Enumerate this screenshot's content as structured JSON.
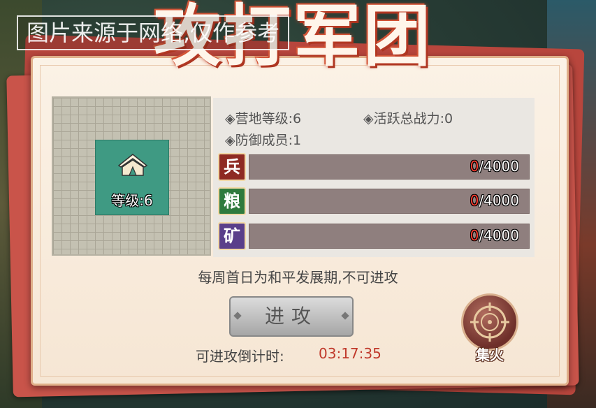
{
  "title": "攻打军团",
  "watermark": "图片来源于网络,仅作参考",
  "camp": {
    "level_label": "等级:6"
  },
  "stats": {
    "camp_level": "◈营地等级:6",
    "active_power": "◈活跃总战力:0",
    "defense_members": "◈防御成员:1"
  },
  "resources": [
    {
      "icon": "兵",
      "current": "0",
      "max": "/4000",
      "color": "#8e2a23",
      "progress": 0
    },
    {
      "icon": "粮",
      "current": "0",
      "max": "/4000",
      "color": "#2e7a3d",
      "progress": 0
    },
    {
      "icon": "矿",
      "current": "0",
      "max": "/4000",
      "color": "#5a3f8a",
      "progress": 0
    }
  ],
  "notice": "每周首日为和平发展期,不可进攻",
  "attack_button": "进攻",
  "countdown": {
    "label": "可进攻倒计时:",
    "value": "03:17:35"
  },
  "focus_fire": {
    "label": "集火",
    "icon": "crosshair-icon"
  },
  "colors": {
    "panel": "#fbf2e6",
    "frame": "#c9544a",
    "countdown": "#c0392b"
  }
}
